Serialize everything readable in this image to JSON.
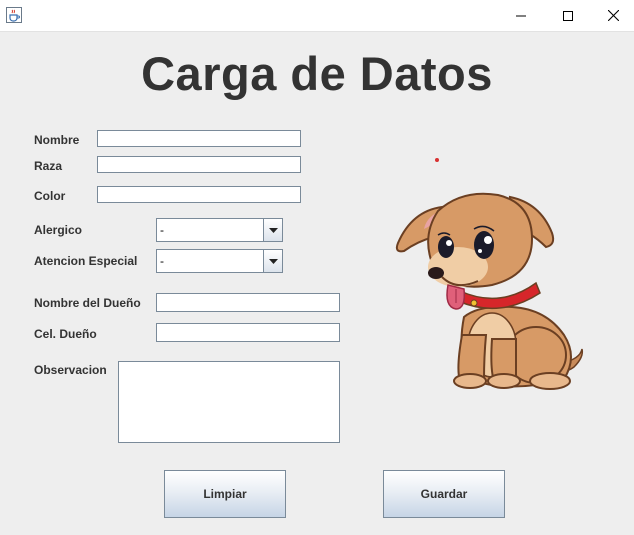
{
  "window": {
    "app_icon": "java-cup-icon",
    "minimize_icon": "minimize-icon",
    "maximize_icon": "maximize-icon",
    "close_icon": "close-icon"
  },
  "form": {
    "title": "Carga de Datos",
    "labels": {
      "nombre": "Nombre",
      "raza": "Raza",
      "color": "Color",
      "alergico": "Alergico",
      "atencion": "Atencion Especial",
      "dueno": "Nombre del Dueño",
      "cel": "Cel. Dueño",
      "observacion": "Observacion"
    },
    "values": {
      "nombre": "",
      "raza": "",
      "color": "",
      "alergico": "-",
      "atencion": "-",
      "dueno": "",
      "cel": "",
      "observacion": ""
    },
    "buttons": {
      "limpiar": "Limpiar",
      "guardar": "Guardar"
    }
  },
  "image": {
    "subject": "cartoon-puppy"
  },
  "colors": {
    "background": "#eeeeee",
    "border": "#7a8a99",
    "text": "#333333",
    "button_gradient_end": "#c6d5e6"
  }
}
